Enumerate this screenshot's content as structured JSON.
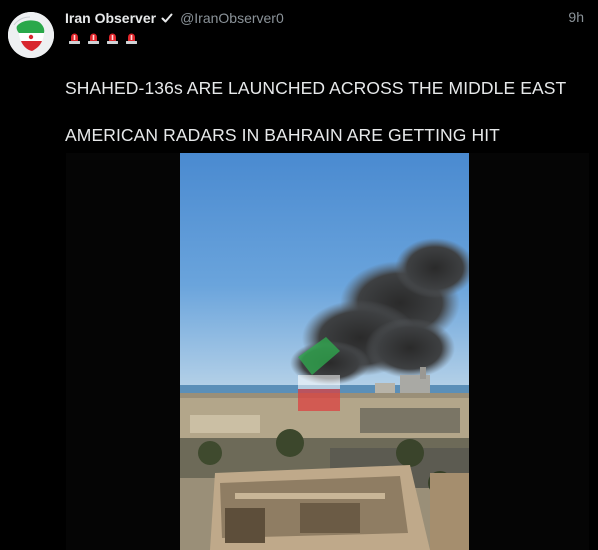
{
  "tweet": {
    "display_name": "Iran Observer",
    "handle": "@IranObserver0",
    "time": "9h",
    "badge_icons": [
      "siren-icon",
      "siren-icon",
      "siren-icon",
      "siren-icon"
    ],
    "text_lines": [
      "SHAHED-136s ARE LAUNCHED ACROSS THE MIDDLE EAST",
      "AMERICAN RADARS IN BAHRAIN ARE GETTING HIT"
    ]
  },
  "icons": {
    "verified": "verified-badge-icon",
    "avatar": "iran-flag-avatar"
  },
  "colors": {
    "background": "#000000",
    "text": "#e7e9ea",
    "muted": "#8b9399",
    "siren_red": "#e0262b"
  }
}
